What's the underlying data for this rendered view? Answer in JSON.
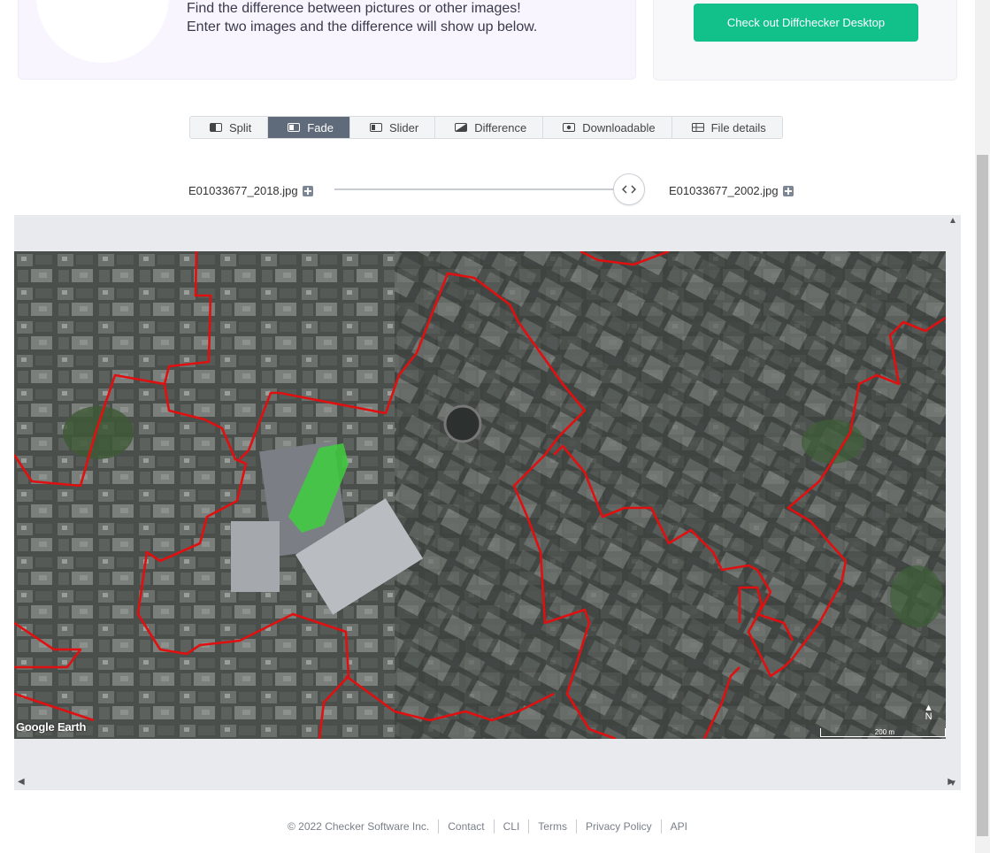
{
  "hero": {
    "line1": "Find the difference between pictures or other images!",
    "line2": "Enter two images and the difference will show up below."
  },
  "promo": {
    "button_label": "Check out Diffchecker Desktop",
    "color": "#12c08a"
  },
  "tabs": [
    {
      "label": "Split",
      "icon": "split-icon",
      "active": false
    },
    {
      "label": "Fade",
      "icon": "fade-icon",
      "active": true
    },
    {
      "label": "Slider",
      "icon": "slider-icon",
      "active": false
    },
    {
      "label": "Difference",
      "icon": "difference-icon",
      "active": false
    },
    {
      "label": "Downloadable",
      "icon": "camera-icon",
      "active": false
    },
    {
      "label": "File details",
      "icon": "table-icon",
      "active": false
    }
  ],
  "files": {
    "left": "E01033677_2018.jpg",
    "right": "E01033677_2002.jpg"
  },
  "fade": {
    "value": 0.95
  },
  "map": {
    "attribution": "Google Earth",
    "scale": "200 m",
    "north": "N",
    "boundary_color": "#e01010",
    "highlight_color": "#3fcf3f"
  },
  "footer": {
    "copyright": "© 2022 Checker Software Inc.",
    "links": [
      "Contact",
      "CLI",
      "Terms",
      "Privacy Policy",
      "API"
    ]
  }
}
